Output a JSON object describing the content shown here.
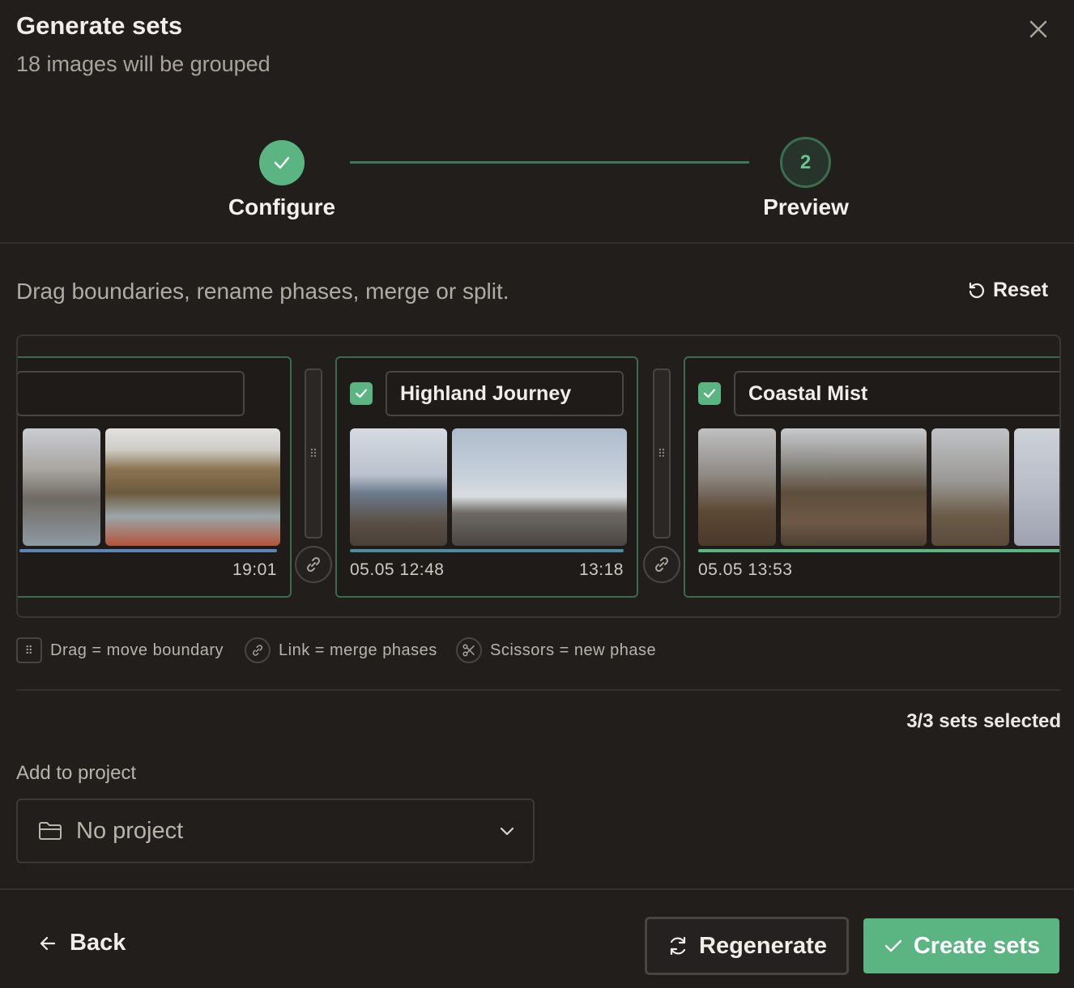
{
  "header": {
    "title": "Generate sets",
    "subtitle": "18 images will be grouped"
  },
  "stepper": {
    "steps": [
      {
        "label": "Configure",
        "state": "complete"
      },
      {
        "label": "Preview",
        "number": "2",
        "state": "current"
      }
    ]
  },
  "instructions": "Drag boundaries, rename phases, merge or split.",
  "reset_label": "Reset",
  "phases": [
    {
      "name": "",
      "start_time": "",
      "end_time": "19:01",
      "checked": null
    },
    {
      "name": "Highland Journey",
      "start_time": "05.05 12:48",
      "end_time": "13:18",
      "checked": true
    },
    {
      "name": "Coastal Mist",
      "start_time": "05.05 13:53",
      "end_time": "",
      "checked": true
    }
  ],
  "legend": {
    "drag": "Drag = move boundary",
    "link": "Link = merge phases",
    "scissors": "Scissors = new phase"
  },
  "selection_status": "3/3 sets selected",
  "project": {
    "label": "Add to project",
    "selected": "No project"
  },
  "footer": {
    "back": "Back",
    "regenerate": "Regenerate",
    "create": "Create sets"
  },
  "colors": {
    "accent": "#5bb583",
    "background": "#211e1c",
    "border": "#3b6a4f"
  }
}
